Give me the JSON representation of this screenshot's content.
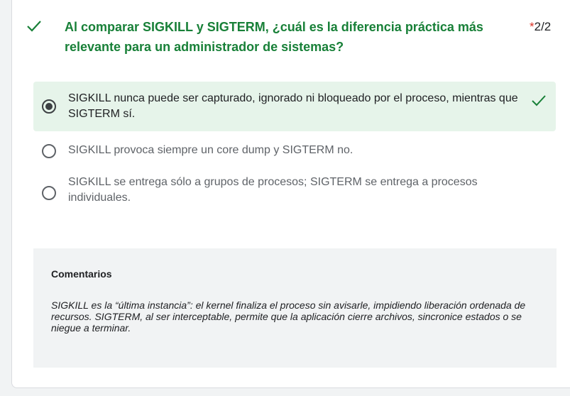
{
  "question": {
    "title": "Al comparar SIGKILL y SIGTERM, ¿cuál es la diferencia práctica más relevante para un administrador de sistemas?",
    "required_marker": "*",
    "score": "2/2",
    "status_icon": "check-icon"
  },
  "options": [
    {
      "label": "SIGKILL nunca puede ser capturado, ignorado ni bloqueado por el proceso, mientras que SIGTERM sí.",
      "selected": true,
      "correct": true
    },
    {
      "label": "SIGKILL provoca siempre un core dump y SIGTERM no.",
      "selected": false
    },
    {
      "label": "SIGKILL se entrega sólo a grupos de procesos; SIGTERM se entrega a procesos individuales.",
      "selected": false
    }
  ],
  "comments": {
    "title": "Comentarios",
    "text": "SIGKILL es la “última instancia”: el kernel finaliza el proceso sin avisarle, impidiendo liberación ordenada de recursos. SIGTERM, al ser interceptable, permite que la aplicación cierre archivos, sincronice estados o se niegue a terminar."
  },
  "colors": {
    "correct_green": "#188038",
    "selected_bg": "#e6f4ea",
    "required_red": "#d93025"
  }
}
